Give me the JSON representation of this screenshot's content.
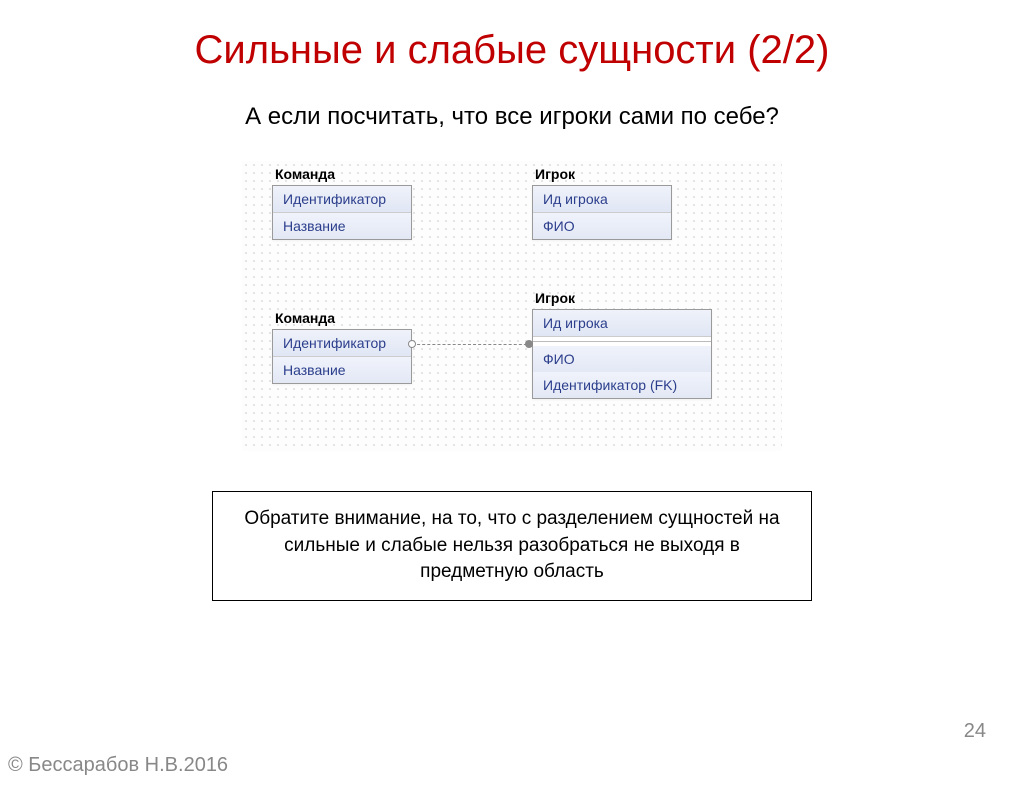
{
  "title": "Сильные и слабые сущности (2/2)",
  "subtitle": "А если посчитать, что все игроки сами по себе?",
  "entities": {
    "team1": {
      "name": "Команда",
      "rows": [
        "Идентификатор",
        "Название"
      ]
    },
    "player1": {
      "name": "Игрок",
      "rows": [
        "Ид игрока",
        "ФИО"
      ]
    },
    "team2": {
      "name": "Команда",
      "rows": [
        "Идентификатор",
        "Название"
      ]
    },
    "player2": {
      "name": "Игрок",
      "rows": [
        "Ид игрока",
        "ФИО",
        "Идентификатор (FK)"
      ]
    }
  },
  "note": "Обратите внимание, на то, что с разделением сущностей на сильные и слабые нельзя разобраться не выходя в предметную область",
  "page_number": "24",
  "copyright": "© Бессарабов Н.В.2016"
}
